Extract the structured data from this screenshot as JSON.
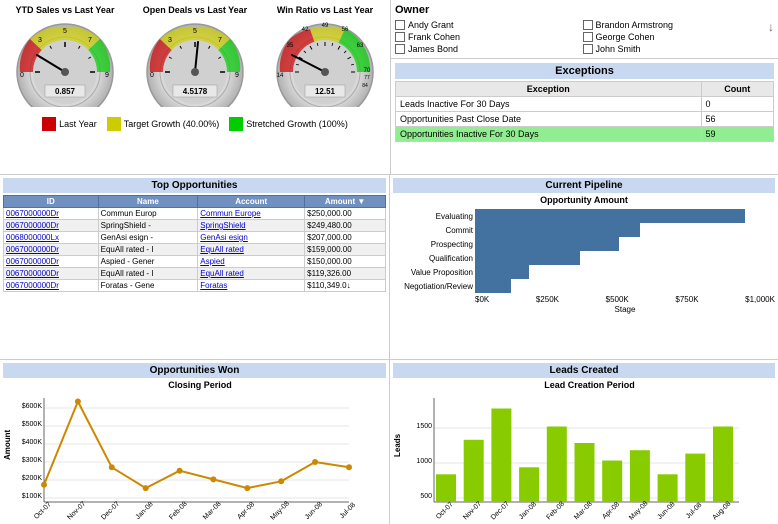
{
  "gauges": [
    {
      "title": "YTD Sales vs Last Year",
      "value": "0.857",
      "min": 0,
      "max": 9,
      "needleAngle": -30,
      "markers": [
        0,
        3,
        5,
        7,
        9
      ]
    },
    {
      "title": "Open Deals vs Last Year",
      "value": "4.5178",
      "min": 0,
      "max": 9,
      "needleAngle": 10,
      "markers": [
        0,
        3,
        5,
        7,
        9
      ]
    },
    {
      "title": "Win Ratio vs Last Year",
      "value": "12.51",
      "min": 14,
      "max": 84,
      "needleAngle": -50,
      "markers": [
        14,
        35,
        42,
        49,
        56,
        63,
        70,
        77,
        84
      ]
    }
  ],
  "legend": [
    {
      "label": "Last Year",
      "color": "#cc0000"
    },
    {
      "label": "Target Growth (40.00%)",
      "color": "#cccc00"
    },
    {
      "label": "Stretched Growth (100%)",
      "color": "#00cc00"
    }
  ],
  "owner": {
    "title": "Owner",
    "people": [
      "Andy Grant",
      "Brandon Armstrong",
      "Frank Cohen",
      "George Cohen",
      "James Bond",
      "John Smith"
    ]
  },
  "exceptions": {
    "title": "Exceptions",
    "col1": "Exception",
    "col2": "Count",
    "rows": [
      {
        "label": "Leads Inactive For 30 Days",
        "count": "0",
        "highlight": false
      },
      {
        "label": "Opportunities Past Close Date",
        "count": "56",
        "highlight": false
      },
      {
        "label": "Opportunities Inactive For 30 Days",
        "count": "59",
        "highlight": true
      }
    ]
  },
  "topOpportunities": {
    "title": "Top Opportunities",
    "columns": [
      "ID",
      "Name",
      "Account",
      "Amount"
    ],
    "rows": [
      {
        "id": "0067000000Dr",
        "name": "Commun Europ",
        "account": "Commun Europe",
        "amount": "$250,000.00"
      },
      {
        "id": "0067000000Dr",
        "name": "SpringShield -",
        "account": "SpringShield",
        "amount": "$249,480.00"
      },
      {
        "id": "0068000000Lx",
        "name": "GenAsi esign -",
        "account": "GenAsi esign",
        "amount": "$207,000.00"
      },
      {
        "id": "0067000000Dr",
        "name": "EquAll rated - I",
        "account": "EquAll rated",
        "amount": "$159,000.00"
      },
      {
        "id": "0067000000Dr",
        "name": "Aspied - Gener",
        "account": "Aspied",
        "amount": "$150,000.00"
      },
      {
        "id": "0067000000Dr",
        "name": "EquAll rated - I",
        "account": "EquAll rated",
        "amount": "$119,326.00"
      },
      {
        "id": "0067000000Dr",
        "name": "Foratas - Gene",
        "account": "Foratas",
        "amount": "$110,349.0↓"
      }
    ]
  },
  "pipeline": {
    "title": "Current Pipeline",
    "subtitle": "Opportunity Amount",
    "stages": [
      {
        "label": "Evaluating",
        "value": 900,
        "max": 1000
      },
      {
        "label": "Commit",
        "value": 550,
        "max": 1000
      },
      {
        "label": "Prospecting",
        "value": 480,
        "max": 1000
      },
      {
        "label": "Qualification",
        "value": 350,
        "max": 1000
      },
      {
        "label": "Value Proposition",
        "value": 180,
        "max": 1000
      },
      {
        "label": "Negotiation/Review",
        "value": 120,
        "max": 1000
      }
    ],
    "xLabels": [
      "$0K",
      "$250K",
      "$500K",
      "$750K",
      "$1,000K"
    ]
  },
  "opportunitiesWon": {
    "title": "Opportunities Won",
    "subtitle": "Closing Period",
    "yLabel": "Amount",
    "xLabels": [
      "Oct-07",
      "Nov-07",
      "Dec-07",
      "Jan-08",
      "Feb-08",
      "Mar-08",
      "Apr-08",
      "May-08",
      "Jun-08",
      "Jul-08"
    ],
    "values": [
      100,
      580,
      200,
      80,
      180,
      130,
      80,
      120,
      220,
      200
    ],
    "color": "#cc8800"
  },
  "leadsCreated": {
    "title": "Leads Created",
    "subtitle": "Lead Creation Period",
    "yLabel": "Leads",
    "xLabels": [
      "Oct-07",
      "Nov-07",
      "Dec-07",
      "Jan-08",
      "Feb-08",
      "Mar-08",
      "Apr-08",
      "May-08",
      "Jun-08",
      "Jul-08",
      "Aug-08"
    ],
    "values": [
      400,
      900,
      1350,
      500,
      1100,
      850,
      600,
      750,
      400,
      700,
      1100
    ],
    "color": "#88cc00"
  }
}
